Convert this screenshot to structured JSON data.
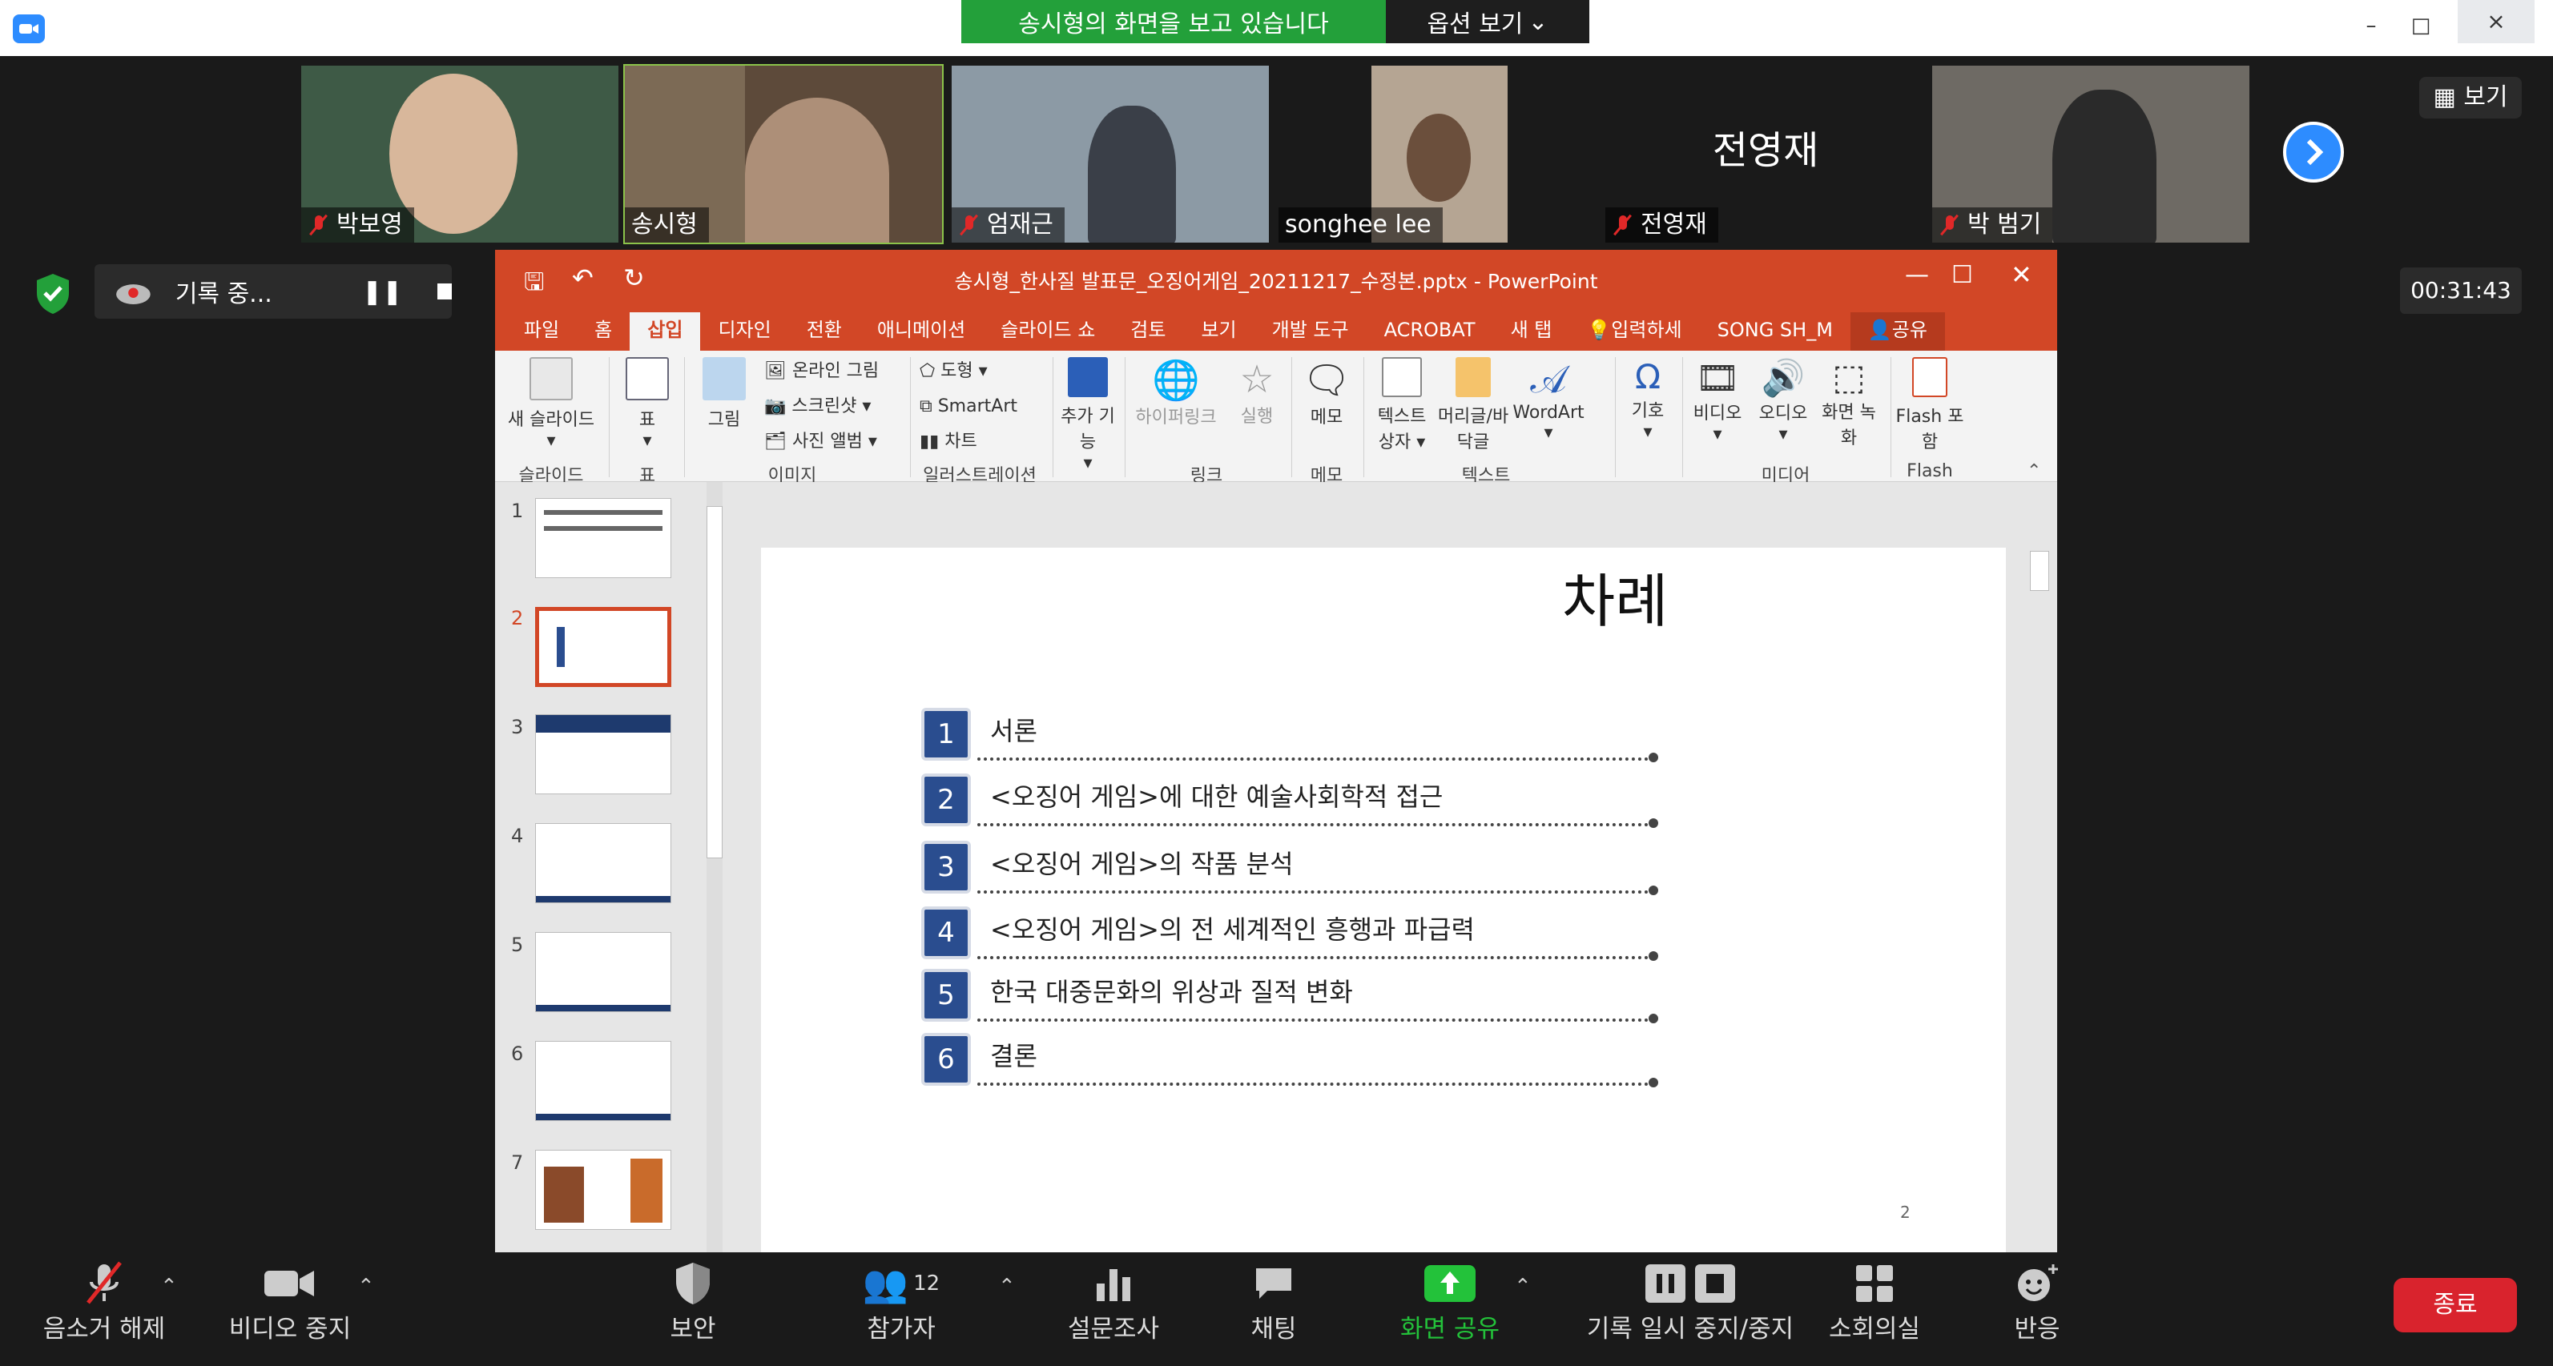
{
  "share_banner": {
    "text": "송시형의 화면을 보고 있습니다",
    "options": "옵션 보기"
  },
  "window_controls": {
    "minimize": "–",
    "maximize": "□",
    "close": "×"
  },
  "participants": [
    {
      "name": "박보영",
      "muted": true
    },
    {
      "name": "송시형",
      "muted": false
    },
    {
      "name": "엄재근",
      "muted": true
    },
    {
      "name": "songhee lee",
      "muted": false
    },
    {
      "name": "전영재",
      "muted": true,
      "display_text": "전영재"
    },
    {
      "name": "박 범기",
      "muted": true
    }
  ],
  "view_button": "보기",
  "recording": {
    "label": "기록 중..."
  },
  "timer": "00:31:43",
  "ppt": {
    "title": "송시형_한사질 발표문_오징어게임_20211217_수정본.pptx - PowerPoint",
    "tabs": [
      "파일",
      "홈",
      "삽입",
      "디자인",
      "전환",
      "애니메이션",
      "슬라이드 쇼",
      "검토",
      "보기",
      "개발 도구",
      "ACROBAT",
      "새 탭"
    ],
    "active_tab": "삽입",
    "tell_me": "입력하세",
    "user": "SONG SH_M",
    "share": "공유",
    "ribbon": {
      "new_slide": "새 슬라이드",
      "table": "표",
      "picture": "그림",
      "online_picture": "온라인 그림",
      "screenshot": "스크린샷",
      "photo_album": "사진 앨범",
      "shapes": "도형",
      "smartart": "SmartArt",
      "chart": "차트",
      "addins": "추가 기능",
      "hyperlink": "하이퍼링크",
      "action": "실행",
      "comment": "메모",
      "textbox": "텍스트 상자",
      "header_footer": "머리글/바닥글",
      "wordart": "WordArt",
      "symbols": "기호",
      "video": "비디오",
      "audio": "오디오",
      "screen_recording": "화면 녹화",
      "flash": "Flash 포함",
      "groups": {
        "slides": "슬라이드",
        "tables": "표",
        "images": "이미지",
        "illustrations": "일러스트레이션",
        "links": "링크",
        "comments": "메모",
        "text": "텍스트",
        "media": "미디어",
        "flash": "Flash"
      }
    },
    "thumb_numbers": [
      "1",
      "2",
      "3",
      "4",
      "5",
      "6",
      "7"
    ],
    "slide": {
      "title": "차례",
      "items": [
        {
          "num": "1",
          "text": "서론"
        },
        {
          "num": "2",
          "text": "<오징어 게임>에 대한 예술사회학적 접근"
        },
        {
          "num": "3",
          "text": "<오징어 게임>의 작품 분석"
        },
        {
          "num": "4",
          "text": "<오징어 게임>의 전 세계적인 흥행과 파급력"
        },
        {
          "num": "5",
          "text": "한국 대중문화의 위상과 질적 변화"
        },
        {
          "num": "6",
          "text": "결론"
        }
      ],
      "page_number": "2"
    }
  },
  "toolbar": {
    "unmute": "음소거 해제",
    "stop_video": "비디오 중지",
    "security": "보안",
    "participants": "참가자",
    "participant_count": "12",
    "polls": "설문조사",
    "chat": "채팅",
    "share_screen": "화면 공유",
    "pause_stop_recording": "기록 일시 중지/중지",
    "breakout": "소회의실",
    "reactions": "반응",
    "end": "종료"
  },
  "colors": {
    "ppt_accent": "#d24726",
    "zoom_blue": "#2d8cff",
    "share_green": "#23a03a",
    "end_red": "#d9232d"
  }
}
